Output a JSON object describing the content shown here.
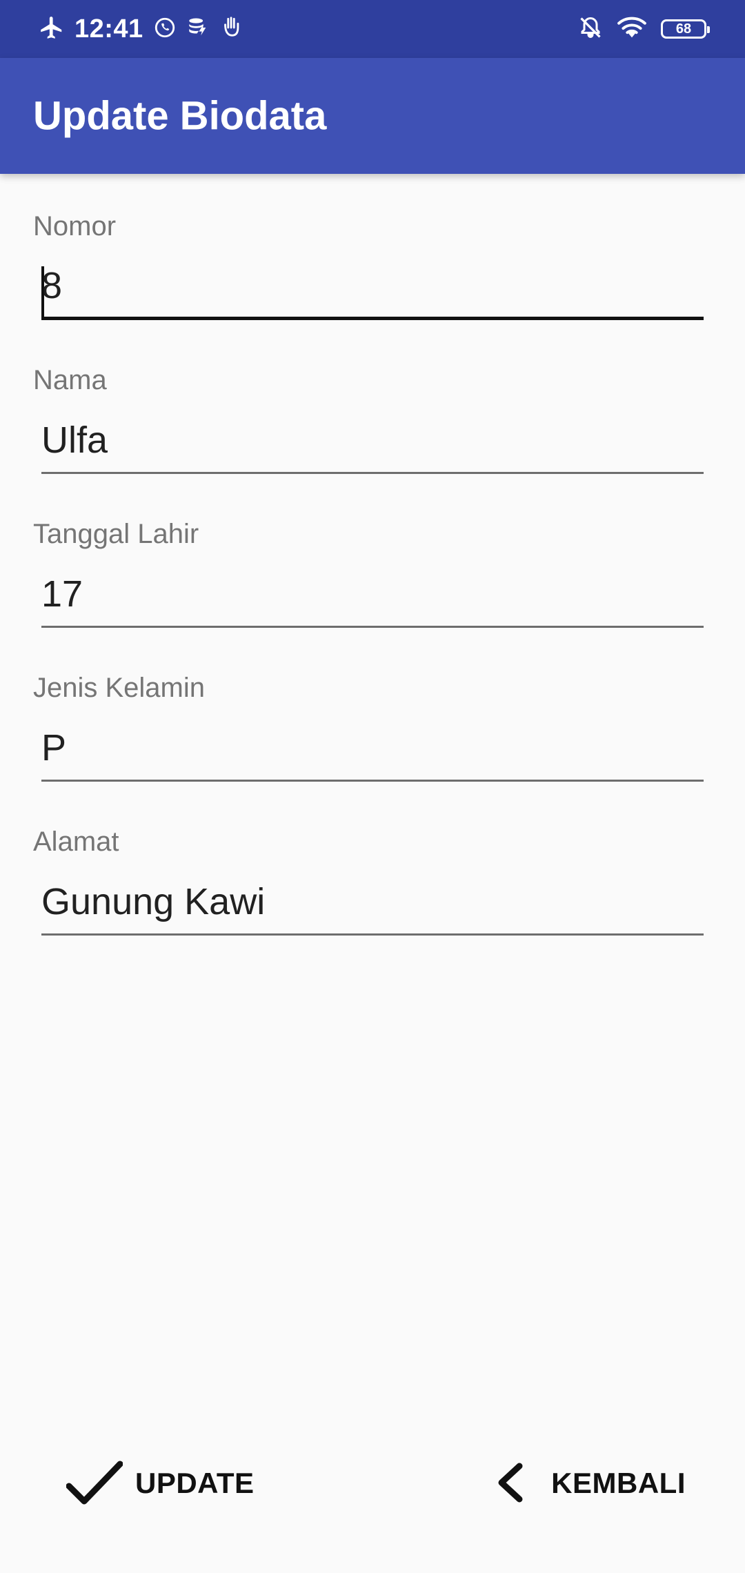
{
  "status_bar": {
    "time": "12:41",
    "battery": "68",
    "icons": [
      "airplane-icon",
      "whatsapp-icon",
      "data-saver-icon",
      "hand-icon",
      "bell-off-icon",
      "wifi-icon",
      "battery-icon"
    ]
  },
  "app_bar": {
    "title": "Update Biodata",
    "color": "#3f51b5",
    "status_color": "#2f3f9e"
  },
  "form": {
    "fields": [
      {
        "label": "Nomor",
        "value": "8"
      },
      {
        "label": "Nama",
        "value": "Ulfa"
      },
      {
        "label": "Tanggal Lahir",
        "value": "17"
      },
      {
        "label": "Jenis Kelamin",
        "value": "P"
      },
      {
        "label": "Alamat",
        "value": "Gunung Kawi"
      }
    ]
  },
  "buttons": {
    "update_label": "UPDATE",
    "back_label": "KEMBALI"
  }
}
